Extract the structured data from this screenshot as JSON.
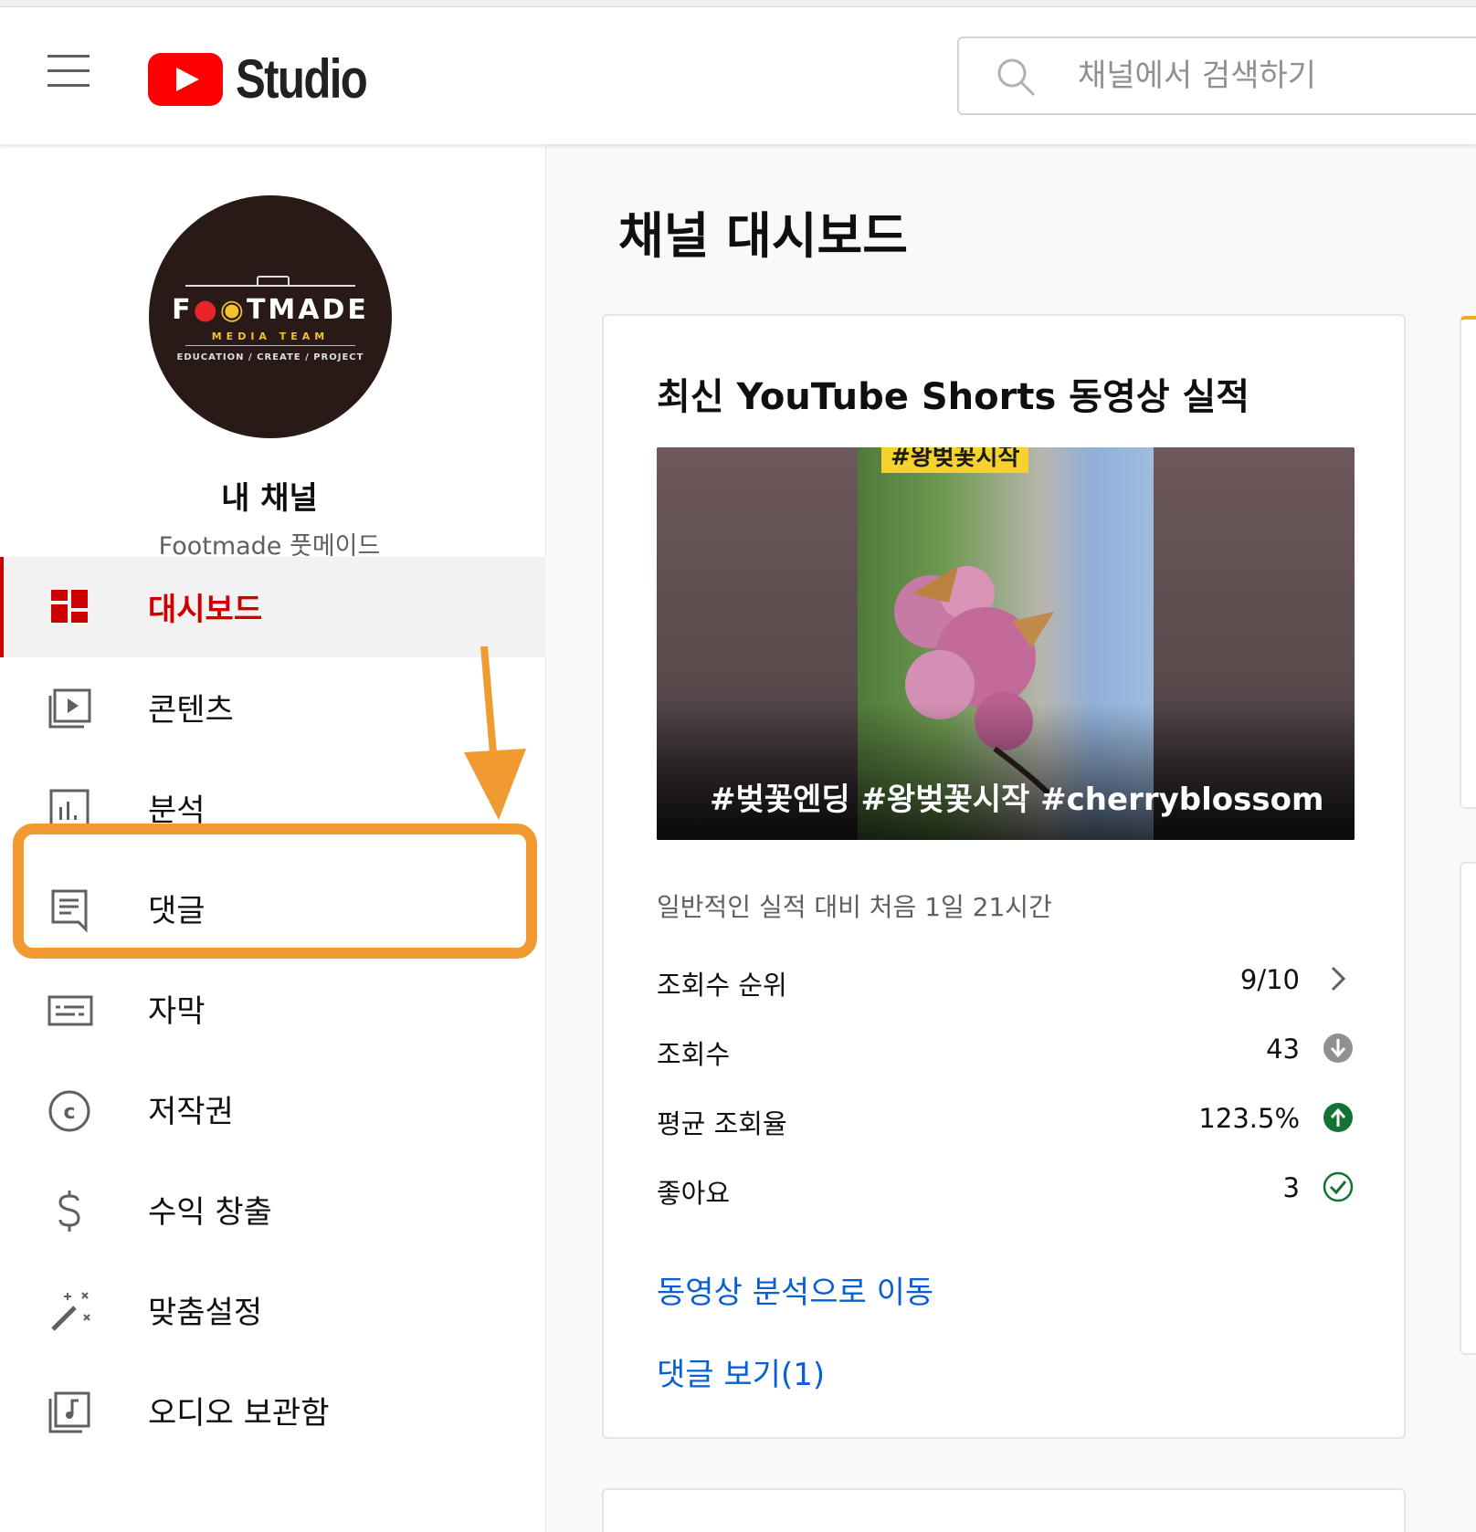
{
  "app": {
    "logo_text": "Studio",
    "search_placeholder": "채널에서 검색하기"
  },
  "channel": {
    "avatar_brand_left": "F",
    "avatar_brand_rest": "TMADE",
    "avatar_subtitle": "MEDIA TEAM",
    "avatar_tagline": "EDUCATION / CREATE / PROJECT",
    "title": "내 채널",
    "subtitle": "Footmade 풋메이드"
  },
  "nav": {
    "items": [
      {
        "label": "대시보드",
        "icon": "dashboard-icon",
        "active": true
      },
      {
        "label": "콘텐츠",
        "icon": "content-icon",
        "active": false
      },
      {
        "label": "분석",
        "icon": "analytics-icon",
        "active": false
      },
      {
        "label": "댓글",
        "icon": "comments-icon",
        "active": false
      },
      {
        "label": "자막",
        "icon": "subtitles-icon",
        "active": false
      },
      {
        "label": "저작권",
        "icon": "copyright-icon",
        "active": false
      },
      {
        "label": "수익 창출",
        "icon": "monetization-icon",
        "active": false
      },
      {
        "label": "맞춤설정",
        "icon": "customization-icon",
        "active": false
      },
      {
        "label": "오디오 보관함",
        "icon": "audio-library-icon",
        "active": false
      }
    ]
  },
  "main": {
    "page_title": "채널 대시보드",
    "card": {
      "title": "최신 YouTube Shorts 동영상 실적",
      "thumbnail_top_tag": "#왕벚꽃시작",
      "thumbnail_caption": "#벚꽃엔딩 #왕벚꽃시작 #cherryblossom",
      "performance_note": "일반적인 실적 대비 처음 1일 21시간",
      "stats": [
        {
          "label": "조회수 순위",
          "value": "9/10",
          "icon": "chevron-right-icon"
        },
        {
          "label": "조회수",
          "value": "43",
          "icon": "arrow-down-circle-icon"
        },
        {
          "label": "평균 조회율",
          "value": "123.5%",
          "icon": "arrow-up-circle-icon"
        },
        {
          "label": "좋아요",
          "value": "3",
          "icon": "check-circle-icon"
        }
      ],
      "link_analytics": "동영상 분석으로 이동",
      "link_comments": "댓글 보기(1)"
    }
  },
  "colors": {
    "brand_red": "#ff0000",
    "active_red": "#cc0000",
    "link_blue": "#065fd4",
    "highlight_orange": "#f09a31",
    "up_green": "#137333",
    "down_gray": "#909090"
  }
}
